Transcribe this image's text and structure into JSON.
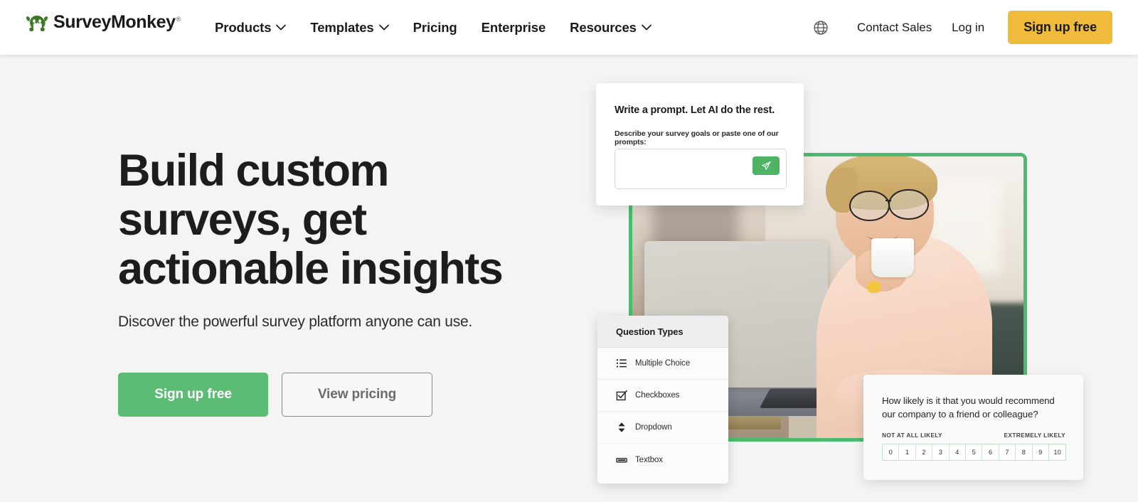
{
  "header": {
    "logo": {
      "text": "SurveyMonkey",
      "tm": "®",
      "icon": "surveymonkey-logo-icon"
    },
    "nav": [
      {
        "label": "Products",
        "has_chevron": true
      },
      {
        "label": "Templates",
        "has_chevron": true
      },
      {
        "label": "Pricing",
        "has_chevron": false
      },
      {
        "label": "Enterprise",
        "has_chevron": false
      },
      {
        "label": "Resources",
        "has_chevron": true
      }
    ],
    "language_icon": "globe-icon",
    "contact_sales": "Contact Sales",
    "log_in": "Log in",
    "signup_button": "Sign up free",
    "signup_button_color": "#f0ba3a"
  },
  "hero": {
    "headline": "Build custom\nsurveys, get\nactionable insights",
    "subhead": "Discover the powerful survey platform anyone can use.",
    "primary_cta": "Sign up free",
    "secondary_cta": "View pricing",
    "primary_cta_color": "#5cbb74",
    "frame_color": "#4cba6f",
    "background_color": "#f4f4f4"
  },
  "ai_card": {
    "title": "Write a prompt. Let AI do the rest.",
    "subtitle": "Describe your survey goals or paste one of our prompts:",
    "input_value": "",
    "input_placeholder": "",
    "send_icon": "paper-plane-icon",
    "send_button_color": "#4cb464"
  },
  "question_types_card": {
    "title": "Question Types",
    "items": [
      {
        "label": "Multiple Choice",
        "icon": "bulleted-list-icon"
      },
      {
        "label": "Checkboxes",
        "icon": "checkbox-icon"
      },
      {
        "label": "Dropdown",
        "icon": "updown-arrows-icon"
      },
      {
        "label": "Textbox",
        "icon": "textbox-icon"
      }
    ]
  },
  "nps_card": {
    "question": "How likely is it that you would recommend our company to a friend or colleague?",
    "low_label": "NOT AT ALL LIKELY",
    "high_label": "EXTREMELY LIKELY",
    "scale": [
      "0",
      "1",
      "2",
      "3",
      "4",
      "5",
      "6",
      "7",
      "8",
      "9",
      "10"
    ]
  }
}
